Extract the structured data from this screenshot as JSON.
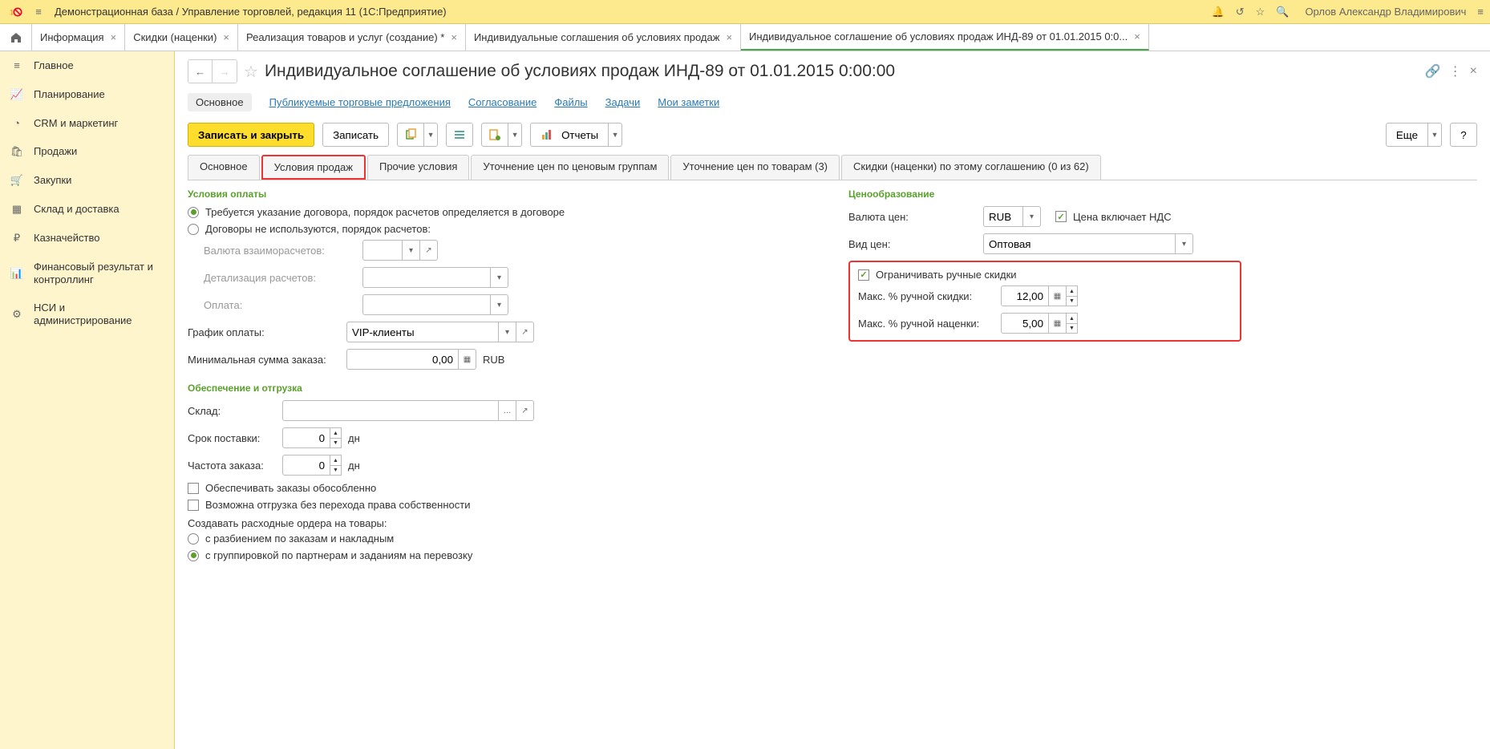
{
  "titlebar": {
    "title": "Демонстрационная база / Управление торговлей, редакция 11  (1С:Предприятие)",
    "user": "Орлов Александр Владимирович"
  },
  "tabs": [
    {
      "label": "Информация"
    },
    {
      "label": "Скидки (наценки)"
    },
    {
      "label": "Реализация товаров и услуг (создание) *"
    },
    {
      "label": "Индивидуальные соглашения об условиях продаж"
    },
    {
      "label": "Индивидуальное соглашение об условиях продаж ИНД-89 от 01.01.2015 0:0...",
      "active": true
    }
  ],
  "sidebar": [
    {
      "icon": "≡",
      "label": "Главное"
    },
    {
      "icon": "📈",
      "label": "Планирование"
    },
    {
      "icon": "◔",
      "label": "CRM и маркетинг"
    },
    {
      "icon": "🛍",
      "label": "Продажи"
    },
    {
      "icon": "🛒",
      "label": "Закупки"
    },
    {
      "icon": "▦",
      "label": "Склад и доставка"
    },
    {
      "icon": "₽",
      "label": "Казначейство"
    },
    {
      "icon": "📊",
      "label": "Финансовый результат и контроллинг"
    },
    {
      "icon": "⚙",
      "label": "НСИ и администрирование"
    }
  ],
  "doc": {
    "title": "Индивидуальное соглашение об условиях продаж ИНД-89 от 01.01.2015 0:00:00",
    "sections": {
      "main": "Основное",
      "offers": "Публикуемые торговые предложения",
      "approval": "Согласование",
      "files": "Файлы",
      "tasks": "Задачи",
      "notes": "Мои заметки"
    },
    "commands": {
      "save_close": "Записать и закрыть",
      "save": "Записать",
      "reports": "Отчеты",
      "more": "Еще"
    },
    "doctabs": {
      "main": "Основное",
      "sales": "Условия продаж",
      "other": "Прочие условия",
      "price_groups": "Уточнение цен по ценовым группам",
      "price_goods": "Уточнение цен по товарам (3)",
      "discounts": "Скидки (наценки) по этому соглашению (0 из 62)"
    },
    "form": {
      "payment_conditions_title": "Условия оплаты",
      "radio_contract": "Требуется указание договора, порядок расчетов определяется в договоре",
      "radio_no_contract": "Договоры не используются, порядок расчетов:",
      "currency_label": "Валюта взаиморасчетов:",
      "detail_label": "Детализация расчетов:",
      "payment_label": "Оплата:",
      "schedule_label": "График оплаты:",
      "schedule_value": "VIP-клиенты",
      "min_order_label": "Минимальная сумма заказа:",
      "min_order_value": "0,00",
      "min_order_currency": "RUB",
      "shipping_title": "Обеспечение и отгрузка",
      "warehouse_label": "Склад:",
      "delivery_label": "Срок поставки:",
      "delivery_value": "0",
      "days": "дн",
      "frequency_label": "Частота заказа:",
      "frequency_value": "0",
      "check_separate": "Обеспечивать заказы обособленно",
      "check_no_transfer": "Возможна отгрузка без перехода права собственности",
      "orders_label": "Создавать расходные ордера на товары:",
      "radio_by_orders": "с разбиением по заказам и накладным",
      "radio_by_partners": "с группировкой по партнерам и заданиям на перевозку",
      "pricing_title": "Ценообразование",
      "price_currency_label": "Валюта цен:",
      "price_currency_value": "RUB",
      "check_vat": "Цена включает НДС",
      "price_type_label": "Вид цен:",
      "price_type_value": "Оптовая",
      "check_limit": "Ограничивать ручные скидки",
      "max_discount_label": "Макс. % ручной скидки:",
      "max_discount_value": "12,00",
      "max_markup_label": "Макс. % ручной наценки:",
      "max_markup_value": "5,00"
    }
  }
}
